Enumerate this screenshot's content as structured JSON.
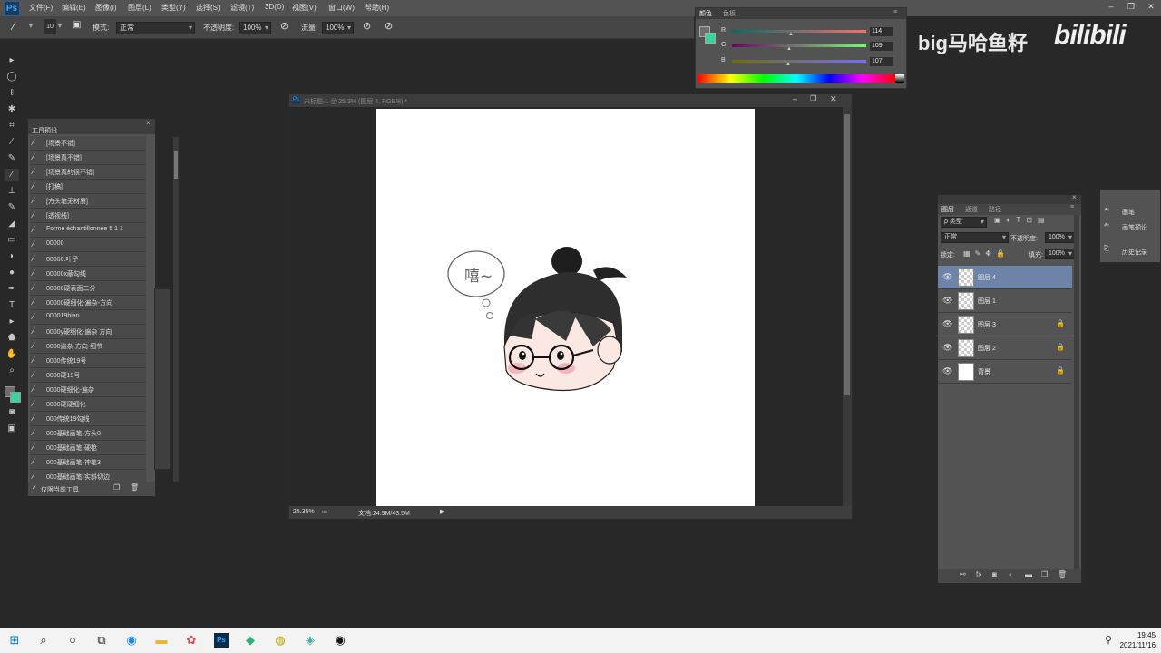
{
  "app": {
    "logo": "Ps"
  },
  "menu": [
    "文件(F)",
    "编辑(E)",
    "图像(I)",
    "图层(L)",
    "类型(Y)",
    "选择(S)",
    "滤镜(T)",
    "3D(D)",
    "视图(V)",
    "窗口(W)",
    "帮助(H)"
  ],
  "options": {
    "brush_size": "10",
    "mode_label": "模式:",
    "mode_value": "正常",
    "opacity_label": "不透明度:",
    "opacity_value": "100%",
    "flow_label": "流量:",
    "flow_value": "100%"
  },
  "color_panel": {
    "tabs": [
      "颜色",
      "色板"
    ],
    "r_label": "R",
    "r_value": "114",
    "g_label": "G",
    "g_value": "109",
    "b_label": "B",
    "b_value": "107",
    "fg_color": "#726d6b",
    "bg_color": "#3ad3a0"
  },
  "watermark": {
    "text": "big马哈鱼籽",
    "logo": "bilibili"
  },
  "tool_presets": {
    "title": "工具预设",
    "items": [
      "[场景不错]",
      "[场景真不错]",
      "[场景真的很不错]",
      "[打稿]",
      "[方头笔无材质]",
      "[透视线]",
      "Forme échantillonnée 5 1 1",
      "00000",
      "00000.叶子",
      "00000x蔽勾线",
      "00000硬表面二分",
      "00000硬细化-遍杂-方向",
      "000019bian",
      "0000y硬细化-遍杂 方向",
      "0000遍杂-方向-细节",
      "0000传统19号",
      "0000硬19号",
      "0000硬细化-遍杂",
      "0000硬硬细化",
      "000传统19勾线",
      "000基础画笔-方头0",
      "000基础画笔-硬枪",
      "000基础画笔-神笔3",
      "000基础画笔-实斜切边"
    ],
    "footer": "仅限当前工具"
  },
  "document": {
    "title": "未标题-1 @ 25.3% (图层 4, RGB/8) *",
    "zoom": "25.35%",
    "doc_size": "文档:24.9M/43.5M",
    "bubble_text": "嘻~"
  },
  "layers_panel": {
    "tabs": [
      "图层",
      "通道",
      "路径"
    ],
    "filter_label": "ρ 类型",
    "blend_mode": "正常",
    "opacity_label": "不透明度:",
    "opacity_value": "100%",
    "lock_label": "锁定:",
    "fill_label": "填充:",
    "fill_value": "100%",
    "layers": [
      {
        "name": "图层 4",
        "selected": true,
        "locked": false
      },
      {
        "name": "图层 1",
        "selected": false,
        "locked": false
      },
      {
        "name": "图层 3",
        "selected": false,
        "locked": true
      },
      {
        "name": "图层 2",
        "selected": false,
        "locked": true
      },
      {
        "name": "背景",
        "selected": false,
        "locked": true
      }
    ]
  },
  "side_panel": {
    "items": [
      "画笔",
      "画笔预设",
      "历史记录"
    ]
  },
  "taskbar": {
    "time": "19:45",
    "date": "2021/11/16"
  }
}
